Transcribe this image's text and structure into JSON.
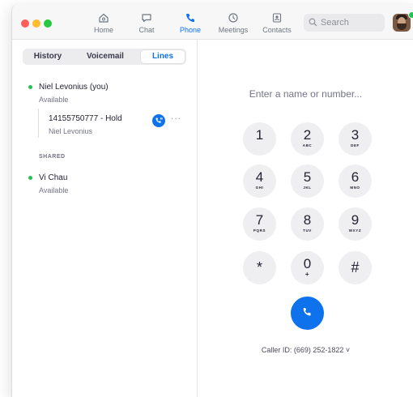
{
  "nav": {
    "home": "Home",
    "chat": "Chat",
    "phone": "Phone",
    "meetings": "Meetings",
    "contacts": "Contacts"
  },
  "search": {
    "placeholder": "Search"
  },
  "colors": {
    "accent": "#0e72ed",
    "online": "#23c552"
  },
  "tabs": {
    "history": "History",
    "voicemail": "Voicemail",
    "lines": "Lines",
    "active": "Lines"
  },
  "lines": {
    "own": {
      "name": "Niel Levonius (you)",
      "status": "Available"
    },
    "call": {
      "number": "14155750777 - Hold",
      "name": "Niel Levonius",
      "more": "···"
    },
    "shared_title": "SHARED",
    "shared": [
      {
        "name": "Vi Chau",
        "status": "Available"
      }
    ]
  },
  "dialpad": {
    "placeholder": "Enter a name or number...",
    "keys": [
      {
        "digit": "1",
        "letters": ""
      },
      {
        "digit": "2",
        "letters": "ABC"
      },
      {
        "digit": "3",
        "letters": "DEF"
      },
      {
        "digit": "4",
        "letters": "GHI"
      },
      {
        "digit": "5",
        "letters": "JKL"
      },
      {
        "digit": "6",
        "letters": "MNO"
      },
      {
        "digit": "7",
        "letters": "PQRS"
      },
      {
        "digit": "8",
        "letters": "TUV"
      },
      {
        "digit": "9",
        "letters": "WXYZ"
      },
      {
        "digit": "*",
        "letters": ""
      },
      {
        "digit": "0",
        "letters": "+"
      },
      {
        "digit": "#",
        "letters": ""
      }
    ],
    "caller_id": "Caller ID: (669) 252-1822 ˅"
  }
}
